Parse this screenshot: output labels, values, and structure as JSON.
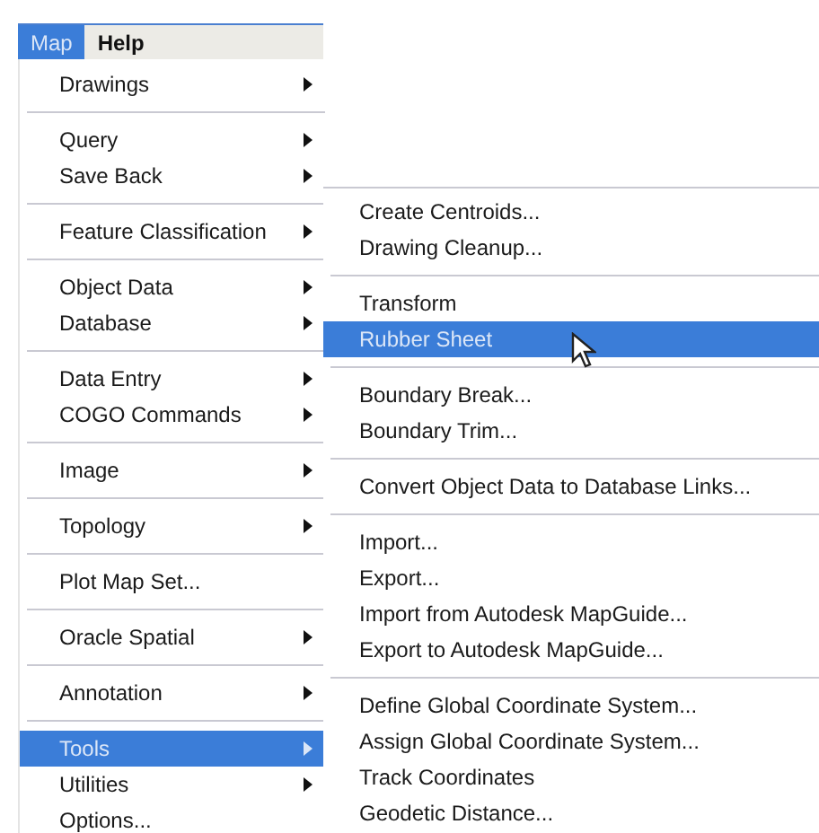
{
  "menubar": [
    {
      "label": "Map",
      "selected": true
    },
    {
      "label": "Help",
      "selected": false
    }
  ],
  "menu": {
    "sections": [
      [
        {
          "label": "Drawings",
          "submenu": true,
          "selected": false
        }
      ],
      [
        {
          "label": "Query",
          "submenu": true,
          "selected": false
        },
        {
          "label": "Save Back",
          "submenu": true,
          "selected": false
        }
      ],
      [
        {
          "label": "Feature Classification",
          "submenu": true,
          "selected": false
        }
      ],
      [
        {
          "label": "Object Data",
          "submenu": true,
          "selected": false
        },
        {
          "label": "Database",
          "submenu": true,
          "selected": false
        }
      ],
      [
        {
          "label": "Data Entry",
          "submenu": true,
          "selected": false
        },
        {
          "label": "COGO Commands",
          "submenu": true,
          "selected": false
        }
      ],
      [
        {
          "label": "Image",
          "submenu": true,
          "selected": false
        }
      ],
      [
        {
          "label": "Topology",
          "submenu": true,
          "selected": false
        }
      ],
      [
        {
          "label": "Plot Map Set...",
          "submenu": false,
          "selected": false
        }
      ],
      [
        {
          "label": "Oracle Spatial",
          "submenu": true,
          "selected": false
        }
      ],
      [
        {
          "label": "Annotation",
          "submenu": true,
          "selected": false
        }
      ],
      [
        {
          "label": "Tools",
          "submenu": true,
          "selected": true
        },
        {
          "label": "Utilities",
          "submenu": true,
          "selected": false
        },
        {
          "label": "Options...",
          "submenu": false,
          "selected": false
        }
      ]
    ]
  },
  "submenu": {
    "sections": [
      [
        {
          "label": "Create Centroids...",
          "selected": false
        },
        {
          "label": "Drawing Cleanup...",
          "selected": false
        }
      ],
      [
        {
          "label": "Transform",
          "selected": false
        },
        {
          "label": "Rubber Sheet",
          "selected": true
        }
      ],
      [
        {
          "label": "Boundary Break...",
          "selected": false
        },
        {
          "label": "Boundary Trim...",
          "selected": false
        }
      ],
      [
        {
          "label": "Convert Object Data to Database Links...",
          "selected": false
        }
      ],
      [
        {
          "label": "Import...",
          "selected": false
        },
        {
          "label": "Export...",
          "selected": false
        },
        {
          "label": "Import from Autodesk MapGuide...",
          "selected": false
        },
        {
          "label": "Export to Autodesk MapGuide...",
          "selected": false
        }
      ],
      [
        {
          "label": "Define Global Coordinate System...",
          "selected": false
        },
        {
          "label": "Assign Global Coordinate System...",
          "selected": false
        },
        {
          "label": "Track Coordinates",
          "selected": false
        },
        {
          "label": "Geodetic Distance...",
          "selected": false
        }
      ]
    ]
  }
}
